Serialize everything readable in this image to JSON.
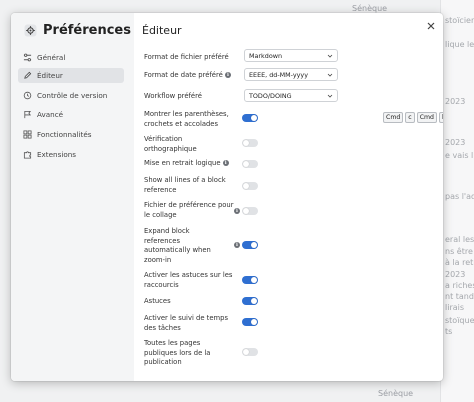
{
  "background": {
    "top_label": "Sénèque",
    "bottom_label": "Sénèque",
    "fragments": [
      "stoïcien",
      "lique le g",
      "2023",
      "e vais lir",
      "2023",
      "pas l'adv",
      "eral les ri",
      "ns être p",
      "à la retra",
      "a richess",
      "nt tandis",
      "lirais",
      "2023",
      "stoïques",
      "ts",
      "Sénèque"
    ]
  },
  "sidebar": {
    "title": "Préférences",
    "items": [
      {
        "label": "Général",
        "icon": "sliders-icon",
        "active": false
      },
      {
        "label": "Éditeur",
        "icon": "pencil-icon",
        "active": true
      },
      {
        "label": "Contrôle de version",
        "icon": "history-icon",
        "active": false
      },
      {
        "label": "Avancé",
        "icon": "flag-icon",
        "active": false
      },
      {
        "label": "Fonctionnalités",
        "icon": "grid-icon",
        "active": false
      },
      {
        "label": "Extensions",
        "icon": "puzzle-icon",
        "active": false
      }
    ]
  },
  "content": {
    "title": "Éditeur",
    "file_format": {
      "label": "Format de fichier préféré",
      "value": "Markdown"
    },
    "date_format": {
      "label": "Format de date préféré",
      "value": "EEEE, dd-MM-yyyy"
    },
    "workflow": {
      "label": "Workflow préféré",
      "value": "TODO/DOING"
    },
    "shortcut_keys": [
      "Cmd",
      "c",
      "Cmd",
      "b"
    ],
    "toggles": [
      {
        "label": "Montrer les parenthèses, crochets et accolades",
        "on": true,
        "info": false
      },
      {
        "label": "Vérification orthographique",
        "on": false,
        "info": false
      },
      {
        "label": "Mise en retrait logique",
        "on": false,
        "info": true
      },
      {
        "label": "Show all lines of a block reference",
        "on": false,
        "info": false
      },
      {
        "label": "Fichier de préférence pour le collage",
        "on": false,
        "info": true
      },
      {
        "label": "Expand block references automatically when zoom-in",
        "on": true,
        "info": true
      },
      {
        "label": "Activer les astuces sur les raccourcis",
        "on": true,
        "info": false
      },
      {
        "label": "Astuces",
        "on": true,
        "info": false
      },
      {
        "label": "Activer le suivi de temps des tâches",
        "on": true,
        "info": false
      },
      {
        "label": "Toutes les pages publiques lors de la publication",
        "on": false,
        "info": false
      }
    ]
  },
  "colors": {
    "accent": "#2f6fd1",
    "toggle_off": "#e0e2e5",
    "sidebar_bg": "#f4f5f6"
  }
}
